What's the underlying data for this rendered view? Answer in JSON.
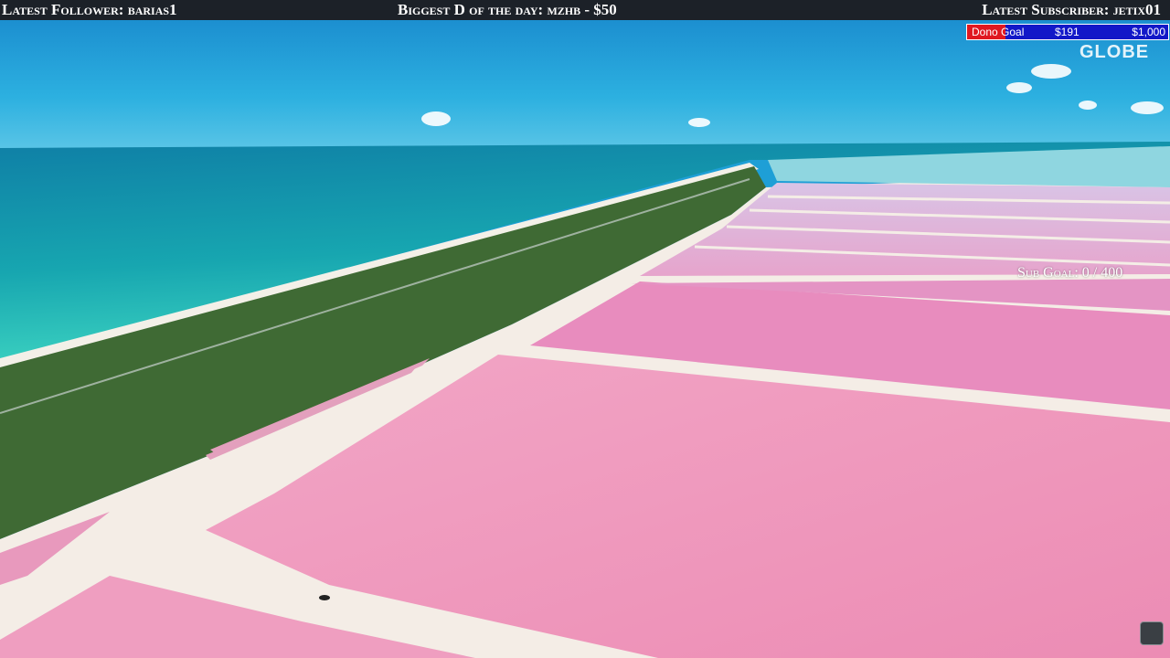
{
  "topbar": {
    "latest_follower": "Latest Follower: barias1",
    "biggest_donation": "Biggest D of the day: mzhb - $50",
    "latest_subscriber": "Latest Subscriber: jetix01"
  },
  "donation_goal": {
    "label": "Dono Goal",
    "current": "$191",
    "target": "$1,000",
    "progress_fraction": 0.191,
    "fill_color": "#e01820",
    "bar_color": "#1218c8"
  },
  "channel_brand": "GLOBE",
  "sub_goal": "Sub Goal: 0 / 400",
  "colors": {
    "topbar_bg": "#1c2128",
    "sky": "#1e9fd6",
    "ocean": "#18a6b8",
    "vegetation": "#3f6a34",
    "salt_lagoon": "#ec94b8",
    "salt_flat": "#f4ede6"
  }
}
